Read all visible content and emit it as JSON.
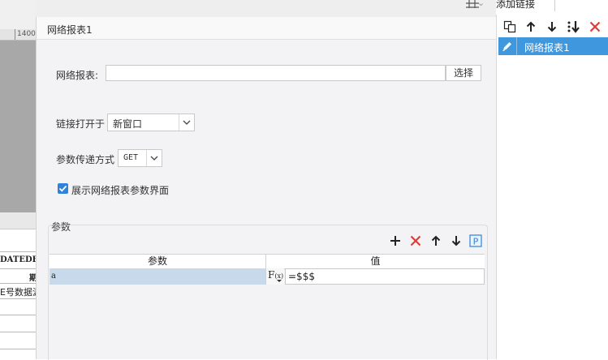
{
  "background": {
    "ruler_label": "1400",
    "sheet_row_text_1": "DATEDEI",
    "sheet_row_text_2": "期",
    "sheet_row_text_3": "E号数据源"
  },
  "dialog": {
    "title": "网络报表1",
    "report_label": "网络报表:",
    "report_value": "",
    "select_button": "选择",
    "open_in_label": "链接打开于",
    "open_in_value": "新窗口",
    "method_label": "参数传递方式",
    "method_value": "GET",
    "show_params_label": "展示网络报表参数界面",
    "show_params_checked": true,
    "params_section_label": "参数",
    "toolbar_icons": [
      "add-icon",
      "delete-icon",
      "move-up-icon",
      "move-down-icon",
      "p-icon"
    ],
    "table": {
      "columns": [
        "参数",
        "值"
      ],
      "rows": [
        {
          "param": "a",
          "fx_label": "F",
          "fx_sub": "(x)",
          "value": "=$$$"
        }
      ]
    }
  },
  "right_panel": {
    "tab_label": "添加链接",
    "toolbar_icons": [
      "copy-icon",
      "move-up-icon",
      "move-down-icon",
      "sort-icon",
      "delete-icon"
    ],
    "items": [
      {
        "label": "网络报表1",
        "selected": true
      }
    ]
  },
  "colors": {
    "accent": "#3f97de",
    "checkbox": "#2f82d8",
    "delete_red": "#e03a3a",
    "selected_param_row": "#c7d9ea",
    "dialog_bg": "#f3f3f5"
  }
}
